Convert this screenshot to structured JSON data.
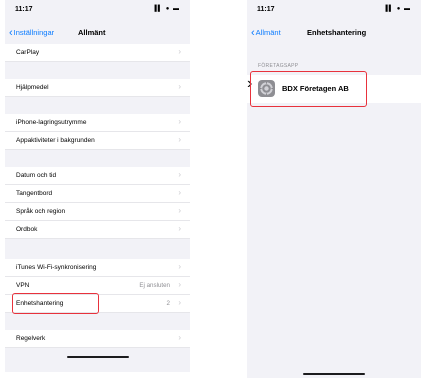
{
  "left": {
    "time": "11:17",
    "status_icons": "▐▌ ● ▬",
    "back_label": "Inställningar",
    "title": "Allmänt",
    "rows": [
      {
        "label": "CarPlay",
        "value": ""
      },
      {
        "label": "Hjälpmedel",
        "value": ""
      },
      {
        "label": "iPhone-lagringsutrymme",
        "value": ""
      },
      {
        "label": "Appaktiviteter i bakgrunden",
        "value": ""
      },
      {
        "label": "Datum och tid",
        "value": ""
      },
      {
        "label": "Tangentbord",
        "value": ""
      },
      {
        "label": "Språk och region",
        "value": ""
      },
      {
        "label": "Ordbok",
        "value": ""
      },
      {
        "label": "iTunes Wi-Fi-synkronisering",
        "value": ""
      },
      {
        "label": "VPN",
        "value": "Ej ansluten"
      },
      {
        "label": "Enhetshantering",
        "value": "2"
      },
      {
        "label": "Regelverk",
        "value": ""
      }
    ]
  },
  "right": {
    "time": "11:17",
    "status_icons": "▐▌ ● ▬",
    "back_label": "Allmänt",
    "title": "Enhetshantering",
    "section_header": "FÖRETAGSAPP",
    "company": "BDX Företagen AB"
  },
  "colors": {
    "accent": "#0a7bff",
    "highlight": "#e8323c",
    "background": "#f2f2f7"
  },
  "icons": {
    "back": "chevron-left-icon",
    "disclosure": "chevron-right-icon",
    "app": "settings-gear-icon"
  }
}
